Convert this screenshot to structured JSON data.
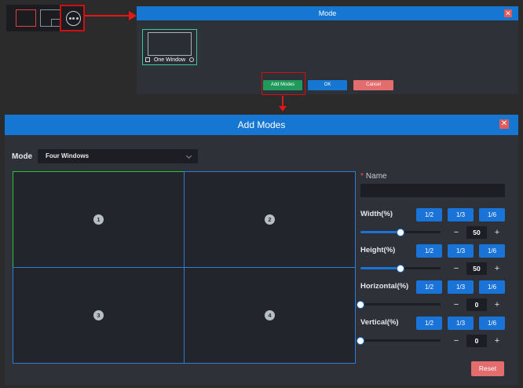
{
  "colors": {
    "accent": "#1677d2",
    "active_cell": "#25c43a",
    "cell_border": "#2f7ad6",
    "add_button": "#1f9a5a",
    "danger": "#e36d6d",
    "highlight_box": "#d01010"
  },
  "toolbar": {
    "icons": [
      "single-window-icon",
      "multi-window-icon",
      "more-icon"
    ]
  },
  "mode_dialog": {
    "title": "Mode",
    "close": "✕",
    "card_label": "One Window",
    "add_label": "Add Modes",
    "ok_label": "OK",
    "cancel_label": "Cancel"
  },
  "add_dialog": {
    "title": "Add Modes",
    "close": "✕",
    "mode_label": "Mode",
    "mode_value": "Four Windows",
    "windows": [
      "1",
      "2",
      "3",
      "4"
    ],
    "name_label": "Name",
    "name_required": "*",
    "name_value": "",
    "fractions": [
      "1/2",
      "1/3",
      "1/6"
    ],
    "controls": [
      {
        "label": "Width(%)",
        "value": "50",
        "level": 50
      },
      {
        "label": "Height(%)",
        "value": "50",
        "level": 50
      },
      {
        "label": "Horizontal(%)",
        "value": "0",
        "level": 0
      },
      {
        "label": "Vertical(%)",
        "value": "0",
        "level": 0
      }
    ],
    "minus": "−",
    "plus": "+",
    "reset_label": "Reset"
  }
}
